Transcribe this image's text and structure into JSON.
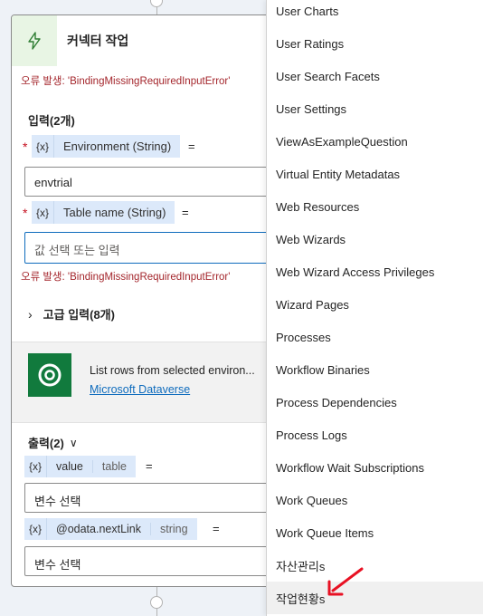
{
  "card": {
    "title": "커넥터 작업",
    "error_top": "오류 발생: 'BindingMissingRequiredInputError'",
    "inputs_title": "입력(2개)",
    "required_mark": "*",
    "fx_label": "{x}",
    "eq": "=",
    "input1": {
      "label": "Environment (String)",
      "value": "envtrial"
    },
    "input2": {
      "label": "Table name (String)",
      "placeholder": "값 선택 또는 입력"
    },
    "error_input2": "오류 발생: 'BindingMissingRequiredInputError'",
    "advanced": "고급 입력(8개)",
    "connector": {
      "description": "List rows from selected environ...",
      "link": "Microsoft Dataverse"
    },
    "outputs_title": "출력(2)",
    "outputs": [
      {
        "name": "value",
        "type": "table",
        "field": "변수 선택"
      },
      {
        "name": "@odata.nextLink",
        "type": "string",
        "field": "변수 선택"
      }
    ]
  },
  "dropdown": {
    "items": [
      "User Charts",
      "User Ratings",
      "User Search Facets",
      "User Settings",
      "ViewAsExampleQuestion",
      "Virtual Entity Metadatas",
      "Web Resources",
      "Web Wizards",
      "Web Wizard Access Privileges",
      "Wizard Pages",
      "Processes",
      "Workflow Binaries",
      "Process Dependencies",
      "Process Logs",
      "Workflow Wait Subscriptions",
      "Work Queues",
      "Work Queue Items",
      "자산관리s",
      "작업현황s"
    ],
    "highlighted_index": 18
  },
  "colors": {
    "accent": "#0f6cbd",
    "error": "#a4262c",
    "arrow": "#e81123",
    "dataverse": "#117a3d"
  }
}
